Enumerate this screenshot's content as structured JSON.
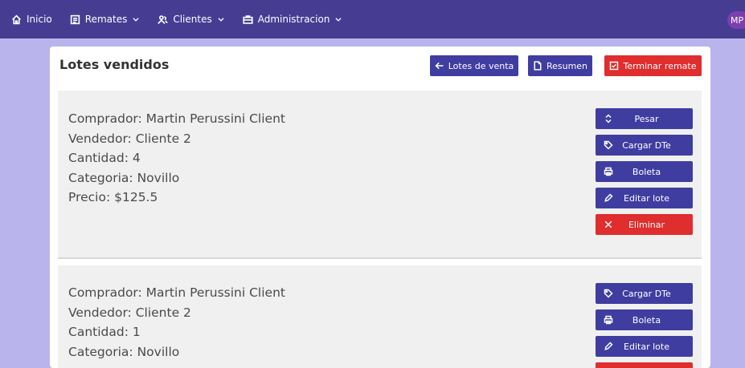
{
  "nav": {
    "items": [
      {
        "label": "Inicio",
        "icon": "home-icon"
      },
      {
        "label": "Remates",
        "icon": "list-icon"
      },
      {
        "label": "Clientes",
        "icon": "users-icon"
      },
      {
        "label": "Administracion",
        "icon": "briefcase-icon"
      }
    ],
    "avatar": "MP"
  },
  "panel": {
    "title": "Lotes vendidos",
    "buttons": {
      "lotes_de_venta": "Lotes de venta",
      "resumen": "Resumen",
      "terminar_remate": "Terminar remate"
    }
  },
  "lotes": [
    {
      "comprador": "Comprador: Martin Perussini Client",
      "vendedor": "Vendedor: Cliente 2",
      "cantidad": "Cantidad: 4",
      "categoria": "Categoria: Novillo",
      "precio": "Precio: $125.5",
      "actions": [
        "Pesar",
        "Cargar DTe",
        "Boleta",
        "Editar lote",
        "Eliminar"
      ]
    },
    {
      "comprador": "Comprador: Martin Perussini Client",
      "vendedor": "Vendedor: Cliente 2",
      "cantidad": "Cantidad: 1",
      "categoria": "Categoria: Novillo",
      "actions": [
        "Cargar DTe",
        "Boleta",
        "Editar lote"
      ]
    }
  ],
  "colors": {
    "navbar": "#463d93",
    "background": "#b9b4ec",
    "primary_button": "#3f3da0",
    "danger_button": "#e02d2d"
  }
}
